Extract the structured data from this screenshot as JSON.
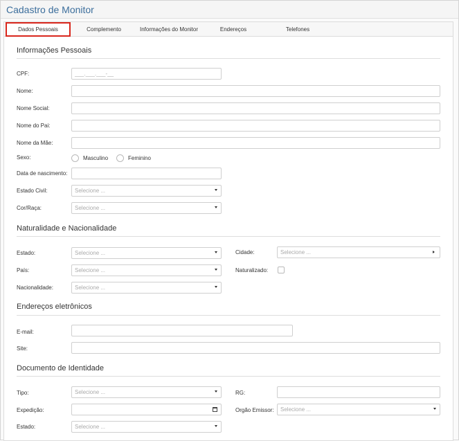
{
  "window": {
    "title": "Cadastro de Monitor"
  },
  "tabs": [
    {
      "label": "Dados Pessoais",
      "active": true
    },
    {
      "label": "Complemento"
    },
    {
      "label": "Informações do Monitor"
    },
    {
      "label": "Endereços"
    },
    {
      "label": "Telefones"
    }
  ],
  "sections": {
    "pessoais": "Informações Pessoais",
    "naturalidade": "Naturalidade e Nacionalidade",
    "eletronicos": "Endereços eletrônicos",
    "documento": "Documento de Identidade"
  },
  "fields": {
    "cpf": {
      "label": "CPF:",
      "placeholder": "___.___.___-__"
    },
    "nome": {
      "label": "Nome:"
    },
    "nome_social": {
      "label": "Nome Social:"
    },
    "nome_pai": {
      "label": "Nome do Pai:"
    },
    "nome_mae": {
      "label": "Nome da Mãe:"
    },
    "sexo": {
      "label": "Sexo:",
      "options": [
        "Masculino",
        "Feminino"
      ]
    },
    "data_nasc": {
      "label": "Data de nascimento:"
    },
    "estado_civil": {
      "label": "Estado Civil:",
      "value": "Selecione ..."
    },
    "cor_raca": {
      "label": "Cor/Raça:",
      "value": "Selecione ..."
    },
    "estado": {
      "label": "Estado:",
      "value": "Selecione ..."
    },
    "cidade": {
      "label": "Cidade:",
      "value": "Selecione ..."
    },
    "pais": {
      "label": "País:",
      "value": "Selecione ..."
    },
    "naturalizado": {
      "label": "Naturalizado:"
    },
    "nacionalidade": {
      "label": "Nacionalidade:",
      "value": "Selecione ..."
    },
    "email": {
      "label": "E-mail:"
    },
    "site": {
      "label": "Site:"
    },
    "tipo": {
      "label": "Tipo:",
      "value": "Selecione ..."
    },
    "rg": {
      "label": "RG:"
    },
    "expedicao": {
      "label": "Expedição:"
    },
    "orgao_emissor": {
      "label": "Orgão Emissor:",
      "value": "Selecione ..."
    },
    "doc_estado": {
      "label": "Estado:",
      "value": "Selecione ..."
    }
  },
  "colors": {
    "title": "#3c6e9c",
    "active_tab_border": "#d9261c"
  }
}
